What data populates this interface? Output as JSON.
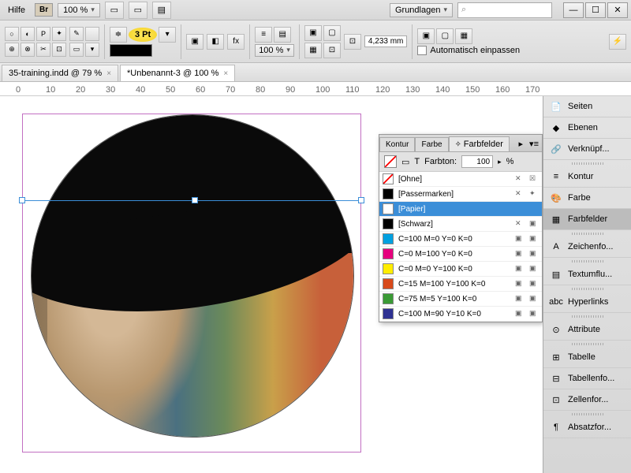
{
  "topbar": {
    "help": "Hilfe",
    "br": "Br",
    "zoom": "100 %",
    "workspace": "Grundlagen",
    "search_placeholder": "⌕"
  },
  "window_buttons": {
    "min": "—",
    "max": "☐",
    "close": "✕"
  },
  "toolbar2": {
    "stroke_weight": "3 Pt",
    "scale": "100 %",
    "dim": "4,233 mm",
    "autofit": "Automatisch einpassen"
  },
  "tabs": [
    {
      "label": "35-training.indd @ 79 %",
      "active": false
    },
    {
      "label": "*Unbenannt-3 @ 100 %",
      "active": true
    }
  ],
  "ruler_marks": [
    "0",
    "10",
    "20",
    "30",
    "40",
    "50",
    "60",
    "70",
    "80",
    "90",
    "100",
    "110",
    "120",
    "130",
    "140",
    "150",
    "160",
    "170"
  ],
  "swatches_panel": {
    "tabs": [
      "Kontur",
      "Farbe",
      "Farbfelder"
    ],
    "active_tab": 2,
    "tint_label": "Farbton:",
    "tint_value": "100",
    "tint_pct": "%",
    "rows": [
      {
        "chip": "none",
        "name": "[Ohne]",
        "i1": "✕",
        "i2": "☒"
      },
      {
        "chip": "#000",
        "name": "[Passermarken]",
        "i1": "✕",
        "i2": "✦"
      },
      {
        "chip": "#fff",
        "name": "[Papier]",
        "sel": true
      },
      {
        "chip": "#000",
        "name": "[Schwarz]",
        "i1": "✕",
        "i2": "▣"
      },
      {
        "chip": "#00a0e0",
        "name": "C=100 M=0 Y=0 K=0",
        "i1": "▣",
        "i2": "▣"
      },
      {
        "chip": "#e6007e",
        "name": "C=0 M=100 Y=0 K=0",
        "i1": "▣",
        "i2": "▣"
      },
      {
        "chip": "#ffed00",
        "name": "C=0 M=0 Y=100 K=0",
        "i1": "▣",
        "i2": "▣"
      },
      {
        "chip": "#d84a1b",
        "name": "C=15 M=100 Y=100 K=0",
        "i1": "▣",
        "i2": "▣"
      },
      {
        "chip": "#3a9a35",
        "name": "C=75 M=5 Y=100 K=0",
        "i1": "▣",
        "i2": "▣"
      },
      {
        "chip": "#2e3192",
        "name": "C=100 M=90 Y=10 K=0",
        "i1": "▣",
        "i2": "▣"
      }
    ]
  },
  "right_rail": [
    {
      "icon": "📄",
      "label": "Seiten"
    },
    {
      "icon": "◆",
      "label": "Ebenen"
    },
    {
      "icon": "🔗",
      "label": "Verknüpf..."
    },
    {
      "sep": true
    },
    {
      "icon": "≡",
      "label": "Kontur"
    },
    {
      "icon": "🎨",
      "label": "Farbe"
    },
    {
      "icon": "▦",
      "label": "Farbfelder",
      "active": true
    },
    {
      "sep": true
    },
    {
      "icon": "A",
      "label": "Zeichenfo..."
    },
    {
      "sep": true
    },
    {
      "icon": "▤",
      "label": "Textumflu..."
    },
    {
      "sep": true
    },
    {
      "icon": "abc",
      "label": "Hyperlinks"
    },
    {
      "sep": true
    },
    {
      "icon": "⊙",
      "label": "Attribute"
    },
    {
      "sep": true
    },
    {
      "icon": "⊞",
      "label": "Tabelle"
    },
    {
      "icon": "⊟",
      "label": "Tabellenfo..."
    },
    {
      "icon": "⊡",
      "label": "Zellenfor..."
    },
    {
      "sep": true
    },
    {
      "icon": "¶",
      "label": "Absatzfor..."
    }
  ]
}
